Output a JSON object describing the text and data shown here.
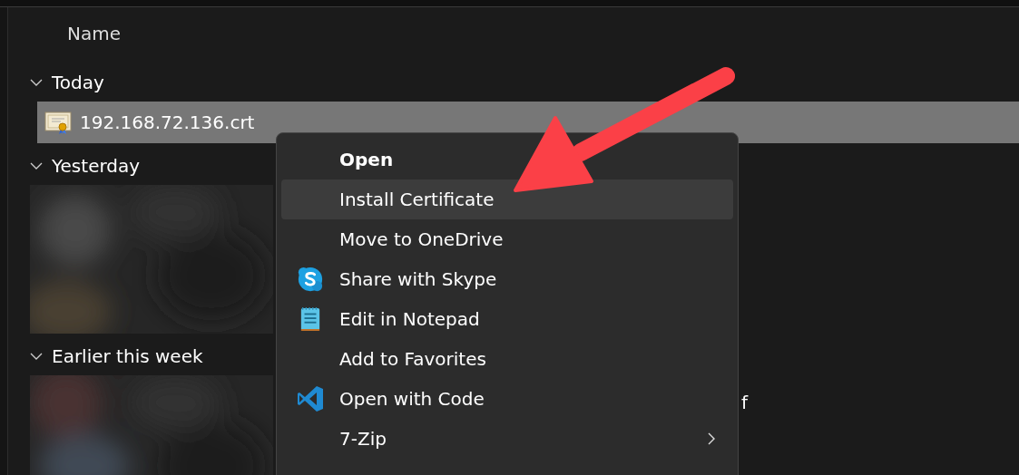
{
  "header": {
    "column": "Name"
  },
  "groups": [
    {
      "label": "Today",
      "expanded": true,
      "rows": [
        {
          "kind": "file",
          "name": "192.168.72.136.crt",
          "selected": true
        }
      ]
    },
    {
      "label": "Yesterday",
      "expanded": true
    },
    {
      "label": "Earlier this week",
      "expanded": true,
      "rows": [
        {
          "kind": "picture",
          "name": "f"
        }
      ]
    }
  ],
  "context_menu": {
    "items": [
      {
        "label": "Open",
        "kind": "plain",
        "default": true,
        "highlighted": false,
        "submenu": false
      },
      {
        "label": "Install Certificate",
        "kind": "plain",
        "default": false,
        "highlighted": true,
        "submenu": false
      },
      {
        "label": "Move to OneDrive",
        "kind": "plain",
        "default": false,
        "highlighted": false,
        "submenu": false
      },
      {
        "label": "Share with Skype",
        "kind": "skype",
        "default": false,
        "highlighted": false,
        "submenu": false
      },
      {
        "label": "Edit in Notepad",
        "kind": "notepad",
        "default": false,
        "highlighted": false,
        "submenu": false
      },
      {
        "label": "Add to Favorites",
        "kind": "plain",
        "default": false,
        "highlighted": false,
        "submenu": false
      },
      {
        "label": "Open with Code",
        "kind": "code",
        "default": false,
        "highlighted": false,
        "submenu": false
      },
      {
        "label": "7-Zip",
        "kind": "plain",
        "default": false,
        "highlighted": false,
        "submenu": true
      }
    ]
  }
}
